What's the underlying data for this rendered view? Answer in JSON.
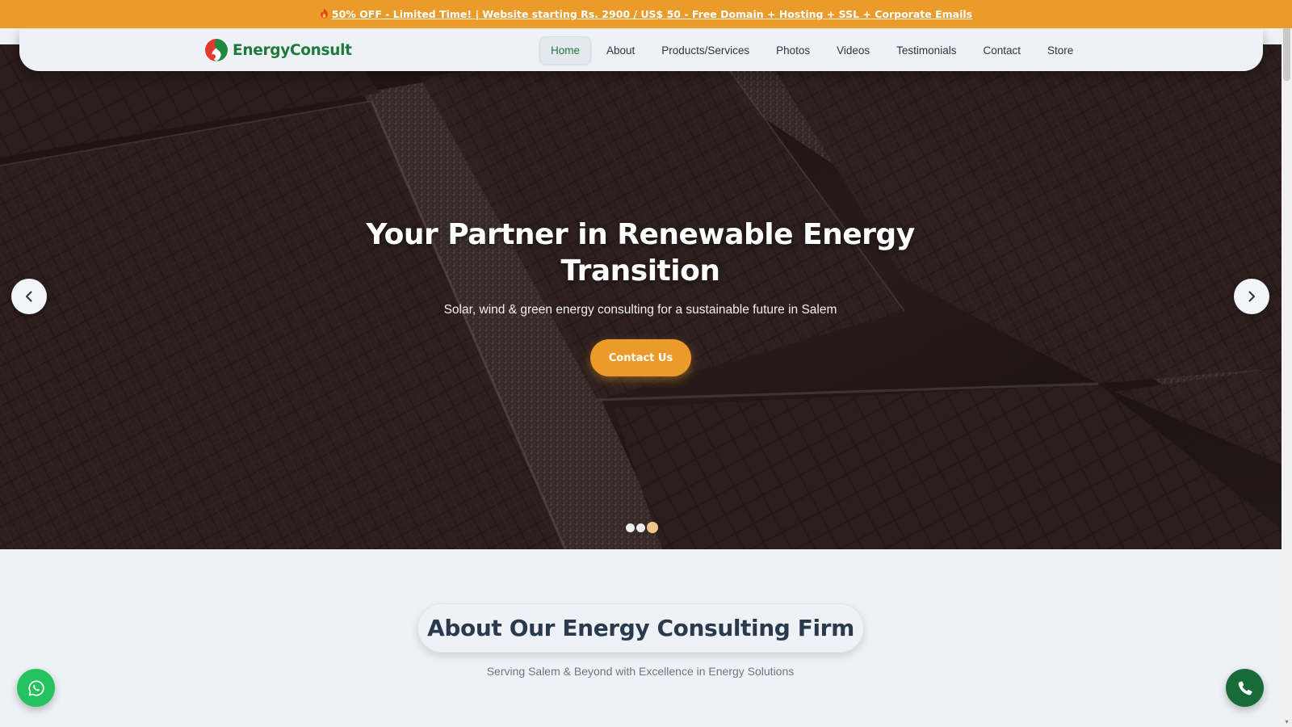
{
  "promo": {
    "text": "50% OFF - Limited Time! | Website starting Rs. 2900 / US$ 50 - Free Domain + Hosting + SSL + Corporate Emails",
    "icon": "fire-icon",
    "color": "#eb9b2a"
  },
  "header": {
    "logo_text": "EnergyConsult",
    "logo_color": "#1e7a3c",
    "nav": [
      {
        "label": "Home",
        "active": true
      },
      {
        "label": "About",
        "active": false
      },
      {
        "label": "Products/Services",
        "active": false
      },
      {
        "label": "Photos",
        "active": false
      },
      {
        "label": "Videos",
        "active": false
      },
      {
        "label": "Testimonials",
        "active": false
      },
      {
        "label": "Contact",
        "active": false
      },
      {
        "label": "Store",
        "active": false
      }
    ]
  },
  "hero": {
    "title": "Your Partner in Renewable Energy Transition",
    "subtitle": "Solar, wind & green energy consulting for a sustainable future in Salem",
    "cta_label": "Contact Us",
    "slides_count": 3,
    "active_slide": 3,
    "prev_icon": "chevron-left-icon",
    "next_icon": "chevron-right-icon"
  },
  "about": {
    "title": "About Our Energy Consulting Firm",
    "subtitle": "Serving Salem & Beyond with Excellence in Energy Solutions"
  },
  "floating": {
    "whatsapp_icon": "whatsapp-icon",
    "phone_icon": "phone-icon",
    "whatsapp_color": "#25c35f",
    "phone_color": "#176b38"
  }
}
